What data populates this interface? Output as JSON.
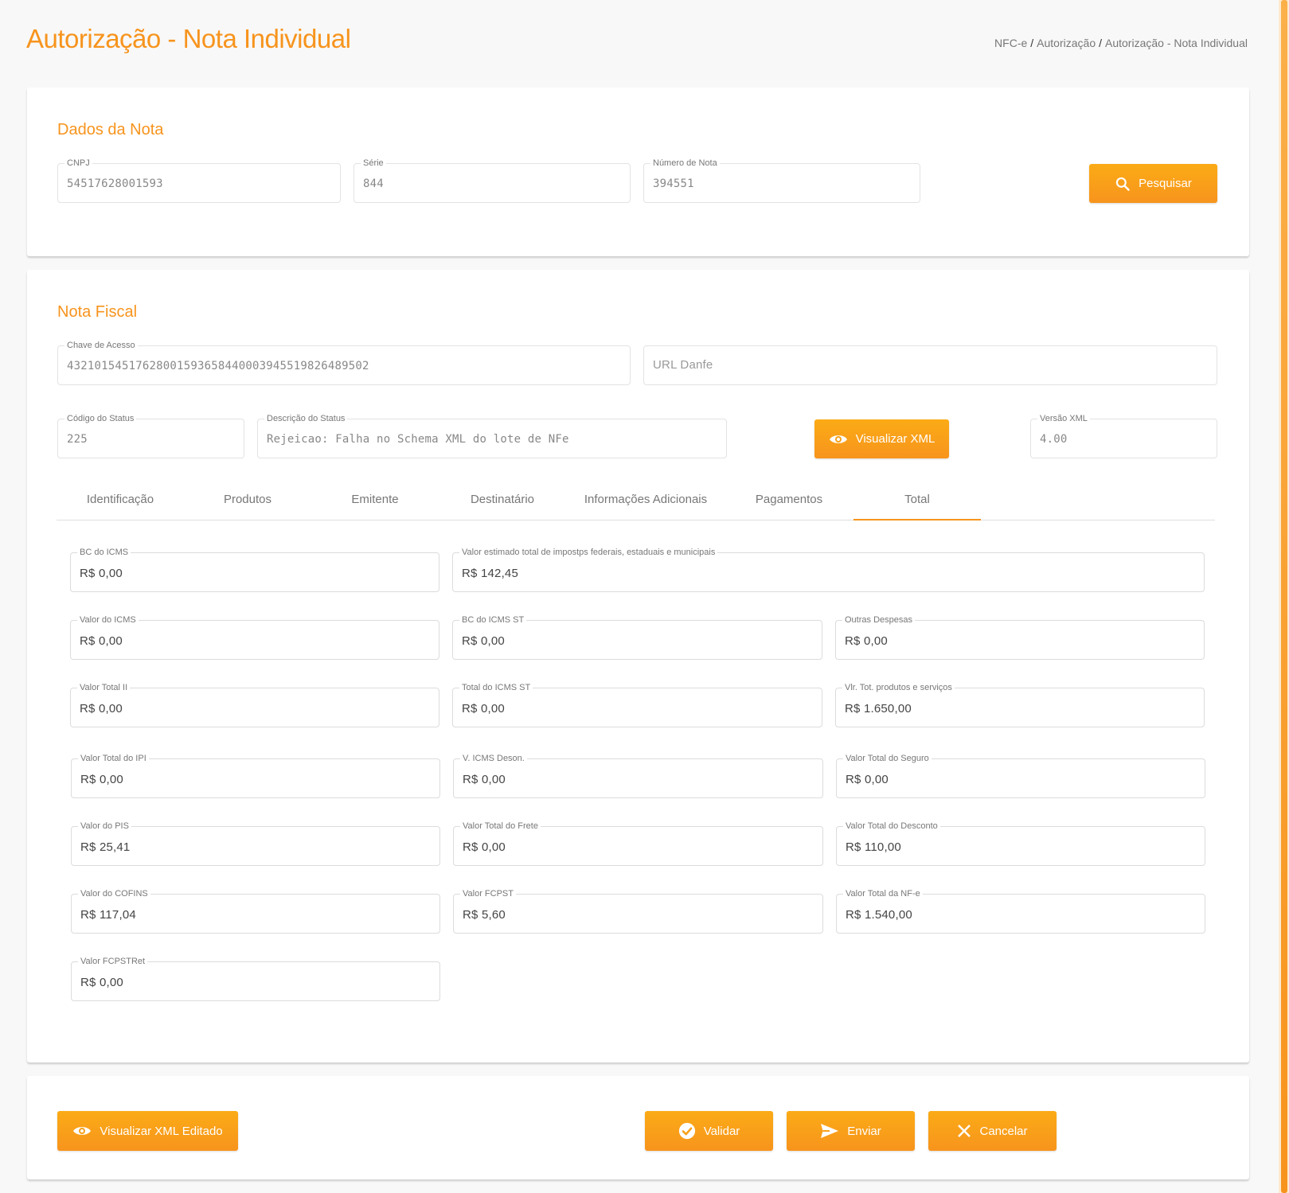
{
  "page": {
    "title": "Autorização - Nota Individual",
    "breadcrumb": [
      "NFC-e",
      "Autorização",
      "Autorização - Nota Individual"
    ]
  },
  "dados_nota": {
    "title": "Dados da Nota",
    "cnpj": {
      "label": "CNPJ",
      "value": "54517628001593"
    },
    "serie": {
      "label": "Série",
      "value": "844"
    },
    "numero": {
      "label": "Número de Nota",
      "value": "394551"
    },
    "search_button": "Pesquisar"
  },
  "nota_fiscal": {
    "title": "Nota Fiscal",
    "chave": {
      "label": "Chave de Acesso",
      "value": "43210154517628001593658440003945519826489502"
    },
    "url_danfe": {
      "placeholder": "URL Danfe"
    },
    "codigo_status": {
      "label": "Código do Status",
      "value": "225"
    },
    "descricao_status": {
      "label": "Descrição do Status",
      "value": "Rejeicao: Falha no Schema XML do lote de NFe"
    },
    "view_xml_button": "Visualizar XML",
    "versao_xml": {
      "label": "Versão XML",
      "value": "4.00"
    },
    "tabs": [
      "Identificação",
      "Produtos",
      "Emitente",
      "Destinatário",
      "Informações Adicionais",
      "Pagamentos",
      "Total"
    ],
    "active_tab": "Total"
  },
  "totais": {
    "bc_icms": {
      "label": "BC do ICMS",
      "value": "R$ 0,00"
    },
    "valor_estimado": {
      "label": "Valor estimado total de impostps federais, estaduais e municipais",
      "value": "R$ 142,45"
    },
    "valor_icms": {
      "label": "Valor do ICMS",
      "value": "R$ 0,00"
    },
    "bc_icms_st": {
      "label": "BC do ICMS ST",
      "value": "R$ 0,00"
    },
    "outras_despesas": {
      "label": "Outras Despesas",
      "value": "R$ 0,00"
    },
    "valor_total_ii": {
      "label": "Valor Total II",
      "value": "R$ 0,00"
    },
    "total_icms_st": {
      "label": "Total do ICMS ST",
      "value": "R$ 0,00"
    },
    "vlr_tot_produtos": {
      "label": "Vlr. Tot. produtos e serviços",
      "value": "R$ 1.650,00"
    },
    "valor_total_ipi": {
      "label": "Valor Total do IPI",
      "value": "R$ 0,00"
    },
    "v_icms_deson": {
      "label": "V. ICMS Deson.",
      "value": "R$ 0,00"
    },
    "valor_total_seguro": {
      "label": "Valor Total do Seguro",
      "value": "R$ 0,00"
    },
    "valor_pis": {
      "label": "Valor do PIS",
      "value": "R$ 25,41"
    },
    "valor_total_frete": {
      "label": "Valor Total do Frete",
      "value": "R$ 0,00"
    },
    "valor_total_desconto": {
      "label": "Valor Total do Desconto",
      "value": "R$ 110,00"
    },
    "valor_cofins": {
      "label": "Valor do COFINS",
      "value": "R$ 117,04"
    },
    "valor_fcpst": {
      "label": "Valor FCPST",
      "value": "R$ 5,60"
    },
    "valor_total_nfe": {
      "label": "Valor Total da NF-e",
      "value": "R$ 1.540,00"
    },
    "valor_fcpstret": {
      "label": "Valor FCPSTRet",
      "value": "R$ 0,00"
    }
  },
  "actions": {
    "view_edited_xml": "Visualizar XML Editado",
    "validate": "Validar",
    "send": "Enviar",
    "cancel": "Cancelar"
  },
  "colors": {
    "accent": "#f7941d",
    "accent_light": "#fbab16",
    "background": "#f8f8f8"
  }
}
